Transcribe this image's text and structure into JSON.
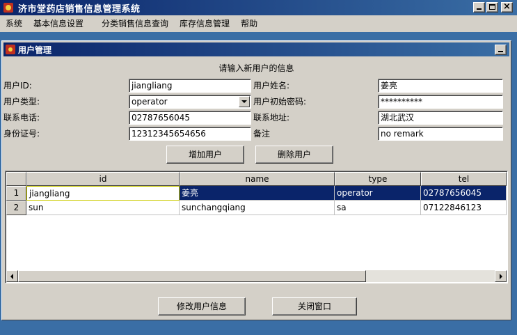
{
  "window": {
    "title": "济市堂药店销售信息管理系统"
  },
  "menu": [
    "系统",
    "基本信息设置",
    "分类销售信息查询",
    "库存信息管理",
    "帮助"
  ],
  "internal_frame": {
    "title": "用户管理"
  },
  "form": {
    "heading": "请输入新用户的信息",
    "user_id_label": "用户ID:",
    "user_id_value": "jiangliang",
    "user_name_label": "用户姓名:",
    "user_name_value": "姜亮",
    "user_type_label": "用户类型:",
    "user_type_value": "operator",
    "initial_password_label": "用户初始密码:",
    "initial_password_value": "**********",
    "phone_label": "联系电话:",
    "phone_value": "02787656045",
    "address_label": "联系地址:",
    "address_value": "湖北武汉",
    "id_card_label": "身份证号:",
    "id_card_value": "12312345654656",
    "remark_label": "备注",
    "remark_value": "no remark"
  },
  "buttons": {
    "add_user": "增加用户",
    "delete_user": "删除用户",
    "modify_user": "修改用户信息",
    "close_window": "关闭窗口"
  },
  "table": {
    "columns": [
      "id",
      "name",
      "type",
      "tel"
    ],
    "rows": [
      {
        "num": "1",
        "id": "jiangliang",
        "name": "姜亮",
        "type": "operator",
        "tel": "02787656045"
      },
      {
        "num": "2",
        "id": "sun",
        "name": "sunchangqiang",
        "type": "sa",
        "tel": "07122846123"
      }
    ]
  },
  "colors": {
    "title_bar": "#0a246a",
    "desktop": "#3a6ea5",
    "face": "#d4d0c8",
    "selection": "#0a246a"
  }
}
